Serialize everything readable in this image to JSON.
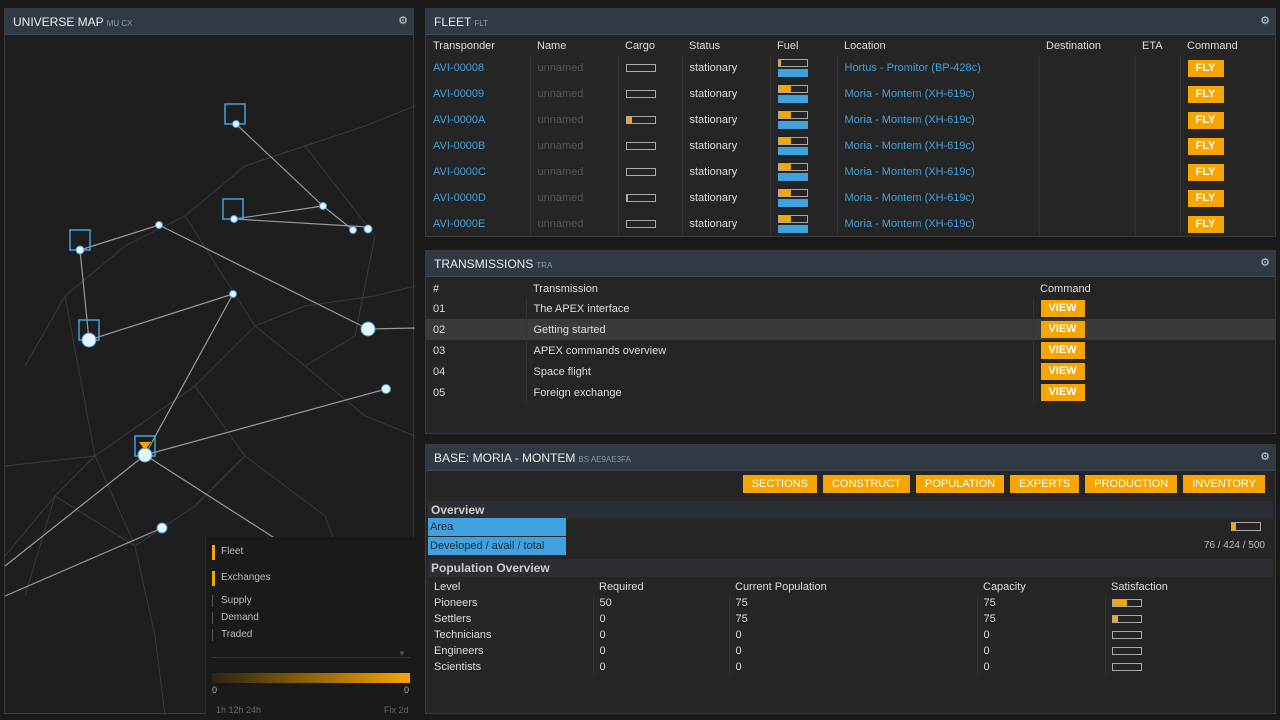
{
  "map": {
    "title": "UNIVERSE MAP",
    "subtitle": "MU CX",
    "legend": {
      "fleet": "Fleet",
      "exchanges": "Exchanges",
      "supply": "Supply",
      "demand": "Demand",
      "traded": "Traded",
      "min": "0",
      "max": "0",
      "ranges": "1h 12h 24h",
      "fix": "Fix 2d"
    }
  },
  "fleet": {
    "title": "FLEET",
    "subtitle": "FLT",
    "columns": [
      "Transponder",
      "Name",
      "Cargo",
      "Status",
      "Fuel",
      "Location",
      "Destination",
      "ETA",
      "Command"
    ],
    "rows": [
      {
        "transponder": "AVI-00008",
        "name": "unnamed",
        "cargo": 0,
        "status": "stationary",
        "fuel": 0.1,
        "location": "Hortus - Promitor (BP-428c)",
        "destination": "",
        "eta": "",
        "command": "FLY"
      },
      {
        "transponder": "AVI-00009",
        "name": "unnamed",
        "cargo": 0,
        "status": "stationary",
        "fuel": 0.45,
        "location": "Moria - Montem (XH-619c)",
        "destination": "",
        "eta": "",
        "command": "FLY"
      },
      {
        "transponder": "AVI-0000A",
        "name": "unnamed",
        "cargo": 0.2,
        "status": "stationary",
        "fuel": 0.45,
        "location": "Moria - Montem (XH-619c)",
        "destination": "",
        "eta": "",
        "command": "FLY"
      },
      {
        "transponder": "AVI-0000B",
        "name": "unnamed",
        "cargo": 0,
        "status": "stationary",
        "fuel": 0.45,
        "location": "Moria - Montem (XH-619c)",
        "destination": "",
        "eta": "",
        "command": "FLY"
      },
      {
        "transponder": "AVI-0000C",
        "name": "unnamed",
        "cargo": 0,
        "status": "stationary",
        "fuel": 0.45,
        "location": "Moria - Montem (XH-619c)",
        "destination": "",
        "eta": "",
        "command": "FLY"
      },
      {
        "transponder": "AVI-0000D",
        "name": "unnamed",
        "cargo": 0.05,
        "status": "stationary",
        "fuel": 0.45,
        "location": "Moria - Montem (XH-619c)",
        "destination": "",
        "eta": "",
        "command": "FLY"
      },
      {
        "transponder": "AVI-0000E",
        "name": "unnamed",
        "cargo": 0,
        "status": "stationary",
        "fuel": 0.45,
        "location": "Moria - Montem (XH-619c)",
        "destination": "",
        "eta": "",
        "command": "FLY"
      }
    ]
  },
  "transmissions": {
    "title": "TRANSMISSIONS",
    "subtitle": "TRA",
    "columns": [
      "#",
      "Transmission",
      "Command"
    ],
    "rows": [
      {
        "num": "01",
        "title": "The APEX interface",
        "command": "VIEW"
      },
      {
        "num": "02",
        "title": "Getting started",
        "command": "VIEW"
      },
      {
        "num": "03",
        "title": "APEX commands overview",
        "command": "VIEW"
      },
      {
        "num": "04",
        "title": "Space flight",
        "command": "VIEW"
      },
      {
        "num": "05",
        "title": "Foreign exchange",
        "command": "VIEW"
      }
    ]
  },
  "base": {
    "title": "BASE: MORIA - MONTEM",
    "subtitle": "BS AE9AE3FA",
    "buttons": [
      "SECTIONS",
      "CONSTRUCT",
      "POPULATION",
      "EXPERTS",
      "PRODUCTION",
      "INVENTORY"
    ],
    "overview_title": "Overview",
    "area_label": "Area",
    "area_fill": 0.15,
    "developed_label": "Developed / avail / total",
    "developed_value": "76 / 424 / 500",
    "population_title": "Population Overview",
    "population_columns": [
      "Level",
      "Required",
      "Current Population",
      "Capacity",
      "Satisfaction"
    ],
    "population_rows": [
      {
        "level": "Pioneers",
        "required": "50",
        "current": "75",
        "capacity": "75",
        "satisfaction": 0.5
      },
      {
        "level": "Settlers",
        "required": "0",
        "current": "75",
        "capacity": "75",
        "satisfaction": 0.2
      },
      {
        "level": "Technicians",
        "required": "0",
        "current": "0",
        "capacity": "0",
        "satisfaction": 0
      },
      {
        "level": "Engineers",
        "required": "0",
        "current": "0",
        "capacity": "0",
        "satisfaction": 0
      },
      {
        "level": "Scientists",
        "required": "0",
        "current": "0",
        "capacity": "0",
        "satisfaction": 0
      }
    ]
  },
  "colors": {
    "accent": "#f7a600",
    "link": "#3fa2de"
  }
}
